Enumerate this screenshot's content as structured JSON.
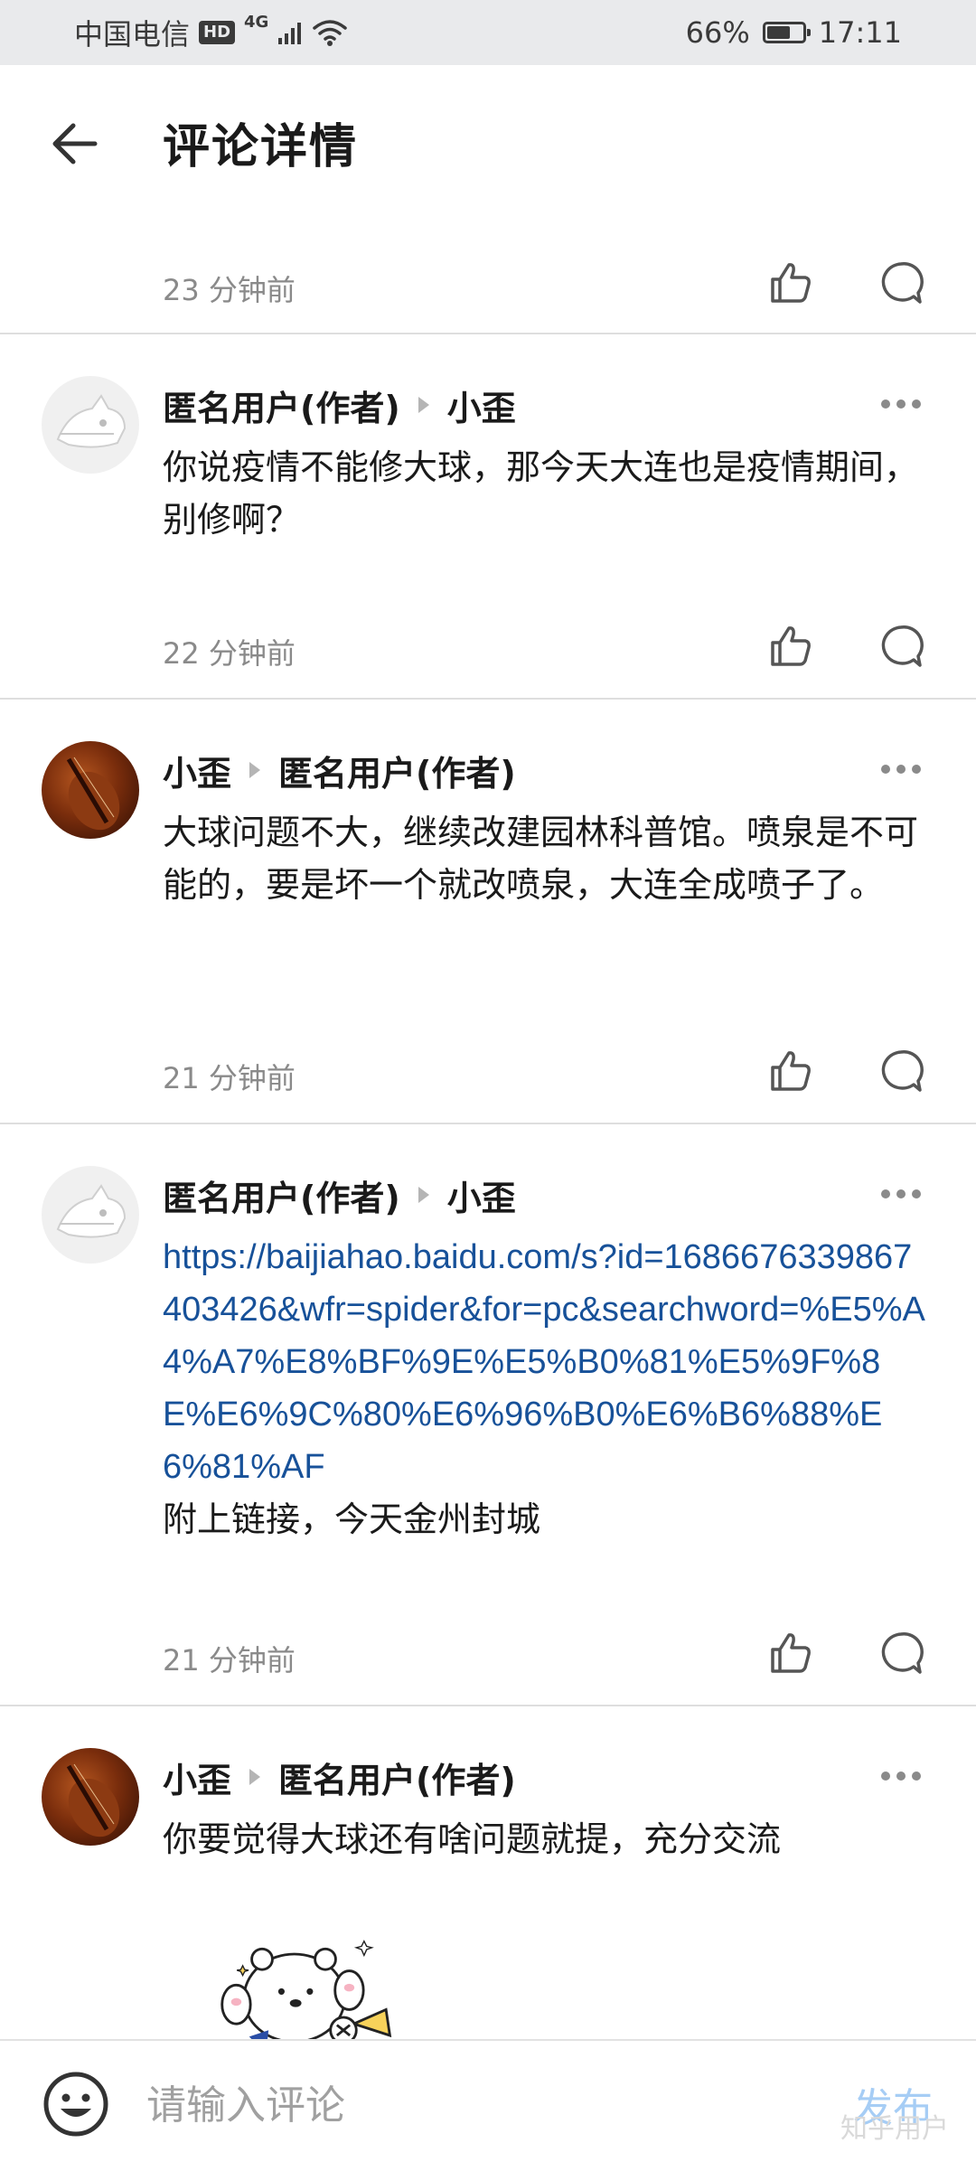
{
  "status_bar": {
    "carrier": "中国电信",
    "hd": "HD",
    "network": "4G",
    "battery": "66%",
    "battery_level": 0.66,
    "time": "17:11"
  },
  "header": {
    "title": "评论详情",
    "back_icon": "arrow-left-icon"
  },
  "top_row": {
    "time": "23 分钟前"
  },
  "comments": [
    {
      "author": "匿名用户(作者)",
      "reply_to": "小歪",
      "avatar": "anonymous-avatar",
      "text": "你说疫情不能修大球，那今天大连也是疫情期间，别修啊？",
      "time": "22 分钟前"
    },
    {
      "author": "小歪",
      "reply_to": "匿名用户(作者)",
      "avatar": "violin-avatar",
      "text": "大球问题不大，继续改建园林科普馆。喷泉是不可能的，要是坏一个就改喷泉，大连全成喷子了。",
      "time": "21 分钟前"
    },
    {
      "author": "匿名用户(作者)",
      "reply_to": "小歪",
      "avatar": "anonymous-avatar",
      "link": "https://baijiahao.baidu.com/s?id=1686676339867403426&wfr=spider&for=pc&searchword=%E5%A4%A7%E8%BF%9E%E5%B0%81%E5%9F%8E%E6%9C%80%E6%96%B0%E6%B6%88%E6%81%AF",
      "text": "附上链接，今天金州封城",
      "time": "21 分钟前"
    },
    {
      "author": "小歪",
      "reply_to": "匿名用户(作者)",
      "avatar": "violin-avatar",
      "text": "你要觉得大球还有啥问题就提，充分交流",
      "sticker": "bear-cheering-sticker"
    }
  ],
  "bottom_bar": {
    "placeholder": "请输入评论",
    "publish_label": "发布",
    "emoji_icon": "smiley-icon"
  },
  "watermark": "知乎用户",
  "colors": {
    "link": "#175199",
    "time": "#8a8a8a",
    "publish_disabled": "#a6cdf5"
  }
}
